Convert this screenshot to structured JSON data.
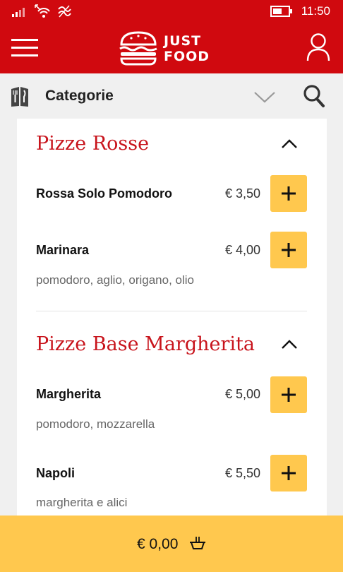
{
  "status_bar": {
    "time": "11:50",
    "icons": [
      "signal-icon",
      "wifi-icon",
      "data-icon",
      "battery-icon"
    ]
  },
  "header": {
    "logo_line1": "JUST",
    "logo_line2": "FOOD",
    "icons": [
      "hamburger-menu-icon",
      "burger-logo-icon",
      "user-icon"
    ],
    "brand_color": "#d0090f"
  },
  "category_bar": {
    "label": "Categorie",
    "icons": [
      "restaurant-menu-icon",
      "chevron-down-icon",
      "search-icon"
    ]
  },
  "sections": [
    {
      "title": "Pizze Rosse",
      "items": [
        {
          "name": "Rossa Solo Pomodoro",
          "price": "€ 3,50",
          "description": ""
        },
        {
          "name": "Marinara",
          "price": "€ 4,00",
          "description": "pomodoro, aglio, origano, olio"
        }
      ]
    },
    {
      "title": "Pizze Base Margherita",
      "items": [
        {
          "name": "Margherita",
          "price": "€ 5,00",
          "description": "pomodoro, mozzarella"
        },
        {
          "name": "Napoli",
          "price": "€ 5,50",
          "description": "margherita e alici"
        }
      ]
    }
  ],
  "cart": {
    "total": "€ 0,00",
    "icon": "shopping-basket-icon",
    "accent_color": "#ffc84e"
  }
}
